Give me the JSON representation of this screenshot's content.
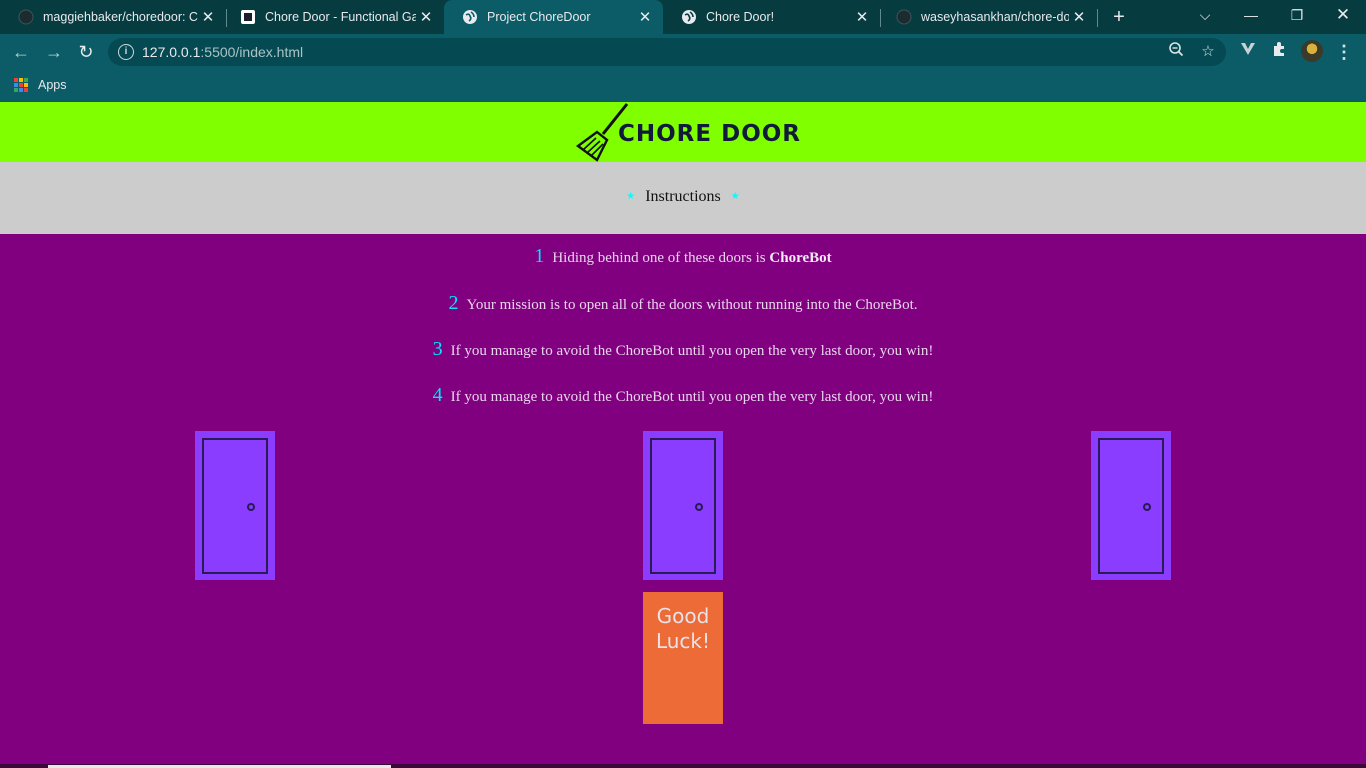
{
  "browser": {
    "tabs": [
      {
        "title": "maggiehbaker/choredoor: Co",
        "icon": "github-icon",
        "active": false
      },
      {
        "title": "Chore Door - Functional Gam",
        "icon": "codecademy-icon",
        "active": false
      },
      {
        "title": "Project ChoreDoor",
        "icon": "globe-icon",
        "active": true
      },
      {
        "title": "Chore Door!",
        "icon": "globe-icon",
        "active": false
      },
      {
        "title": "waseyhasankhan/chore-door",
        "icon": "github-icon",
        "active": false
      }
    ],
    "url_host": "127.0.0.1",
    "url_rest": ":5500/index.html",
    "bookmarks_apps_label": "Apps"
  },
  "page": {
    "title": "CHORE DOOR",
    "instructions_label": "Instructions",
    "steps": [
      {
        "num": "1",
        "text": "Hiding behind one of these doors is ",
        "bold": "ChoreBot"
      },
      {
        "num": "2",
        "text": "Your mission is to open all of the doors without running into the ChoreBot.",
        "bold": ""
      },
      {
        "num": "3",
        "text": "If you manage to avoid the ChoreBot until you open the very last door, you win!",
        "bold": ""
      },
      {
        "num": "4",
        "text": "If you manage to avoid the ChoreBot until you open the very last door, you win!",
        "bold": ""
      }
    ],
    "start_button": "Good Luck!"
  },
  "colors": {
    "header": "#7fff00",
    "background": "#800080",
    "door": "#8a3cff",
    "start": "#ec6b36",
    "accent": "#00ffff"
  }
}
